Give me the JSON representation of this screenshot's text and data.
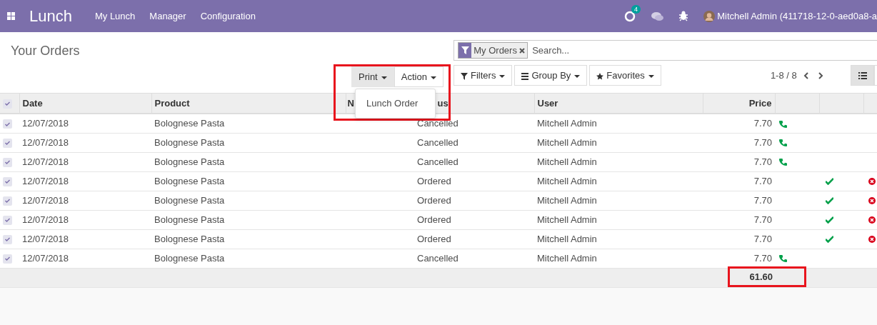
{
  "app": {
    "title": "Lunch",
    "menu": [
      "My Lunch",
      "Manager",
      "Configuration"
    ]
  },
  "systray": {
    "activity_count": "4",
    "user": "Mitchell Admin (411718-12-0-aed0a8-a"
  },
  "page_title": "Your Orders",
  "search": {
    "facets": [
      {
        "label": "My Orders"
      }
    ],
    "placeholder": "Search..."
  },
  "toolbar": {
    "highlighted": true,
    "buttons": [
      {
        "label": "Print",
        "selected": true
      },
      {
        "label": "Action",
        "selected": false
      }
    ],
    "dropdown": [
      "Lunch Order"
    ],
    "search_buttons": [
      {
        "label": "Filters",
        "kind": "filter"
      },
      {
        "label": "Group By",
        "kind": "group"
      },
      {
        "label": "Favorites",
        "kind": "star"
      }
    ],
    "pager": "1-8 / 8"
  },
  "views": [
    {
      "kind": "list",
      "selected": true
    }
  ],
  "table": {
    "header_checked": true,
    "columns": [
      {
        "label": "Date",
        "kind": "text"
      },
      {
        "label": "Product",
        "kind": "text"
      },
      {
        "label": "N",
        "kind": "text"
      },
      {
        "label": "us",
        "kind": "cut"
      },
      {
        "label": "User",
        "kind": "text"
      },
      {
        "label": "Price",
        "kind": "number"
      }
    ],
    "rows": [
      {
        "checked": true,
        "date": "12/07/2018",
        "product": "Bolognese Pasta",
        "status": "Cancelled",
        "user": "Mitchell Admin",
        "price": "7.70",
        "order": true,
        "confirm": false,
        "cancel": false
      },
      {
        "checked": true,
        "date": "12/07/2018",
        "product": "Bolognese Pasta",
        "status": "Cancelled",
        "user": "Mitchell Admin",
        "price": "7.70",
        "order": true,
        "confirm": false,
        "cancel": false
      },
      {
        "checked": true,
        "date": "12/07/2018",
        "product": "Bolognese Pasta",
        "status": "Cancelled",
        "user": "Mitchell Admin",
        "price": "7.70",
        "order": true,
        "confirm": false,
        "cancel": false
      },
      {
        "checked": true,
        "date": "12/07/2018",
        "product": "Bolognese Pasta",
        "status": "Ordered",
        "user": "Mitchell Admin",
        "price": "7.70",
        "order": false,
        "confirm": true,
        "cancel": true
      },
      {
        "checked": true,
        "date": "12/07/2018",
        "product": "Bolognese Pasta",
        "status": "Ordered",
        "user": "Mitchell Admin",
        "price": "7.70",
        "order": false,
        "confirm": true,
        "cancel": true
      },
      {
        "checked": true,
        "date": "12/07/2018",
        "product": "Bolognese Pasta",
        "status": "Ordered",
        "user": "Mitchell Admin",
        "price": "7.70",
        "order": false,
        "confirm": true,
        "cancel": true
      },
      {
        "checked": true,
        "date": "12/07/2018",
        "product": "Bolognese Pasta",
        "status": "Ordered",
        "user": "Mitchell Admin",
        "price": "7.70",
        "order": false,
        "confirm": true,
        "cancel": true
      },
      {
        "checked": true,
        "date": "12/07/2018",
        "product": "Bolognese Pasta",
        "status": "Cancelled",
        "user": "Mitchell Admin",
        "price": "7.70",
        "order": true,
        "confirm": false,
        "cancel": false
      }
    ],
    "total": "61.60",
    "total_highlighted": true
  }
}
